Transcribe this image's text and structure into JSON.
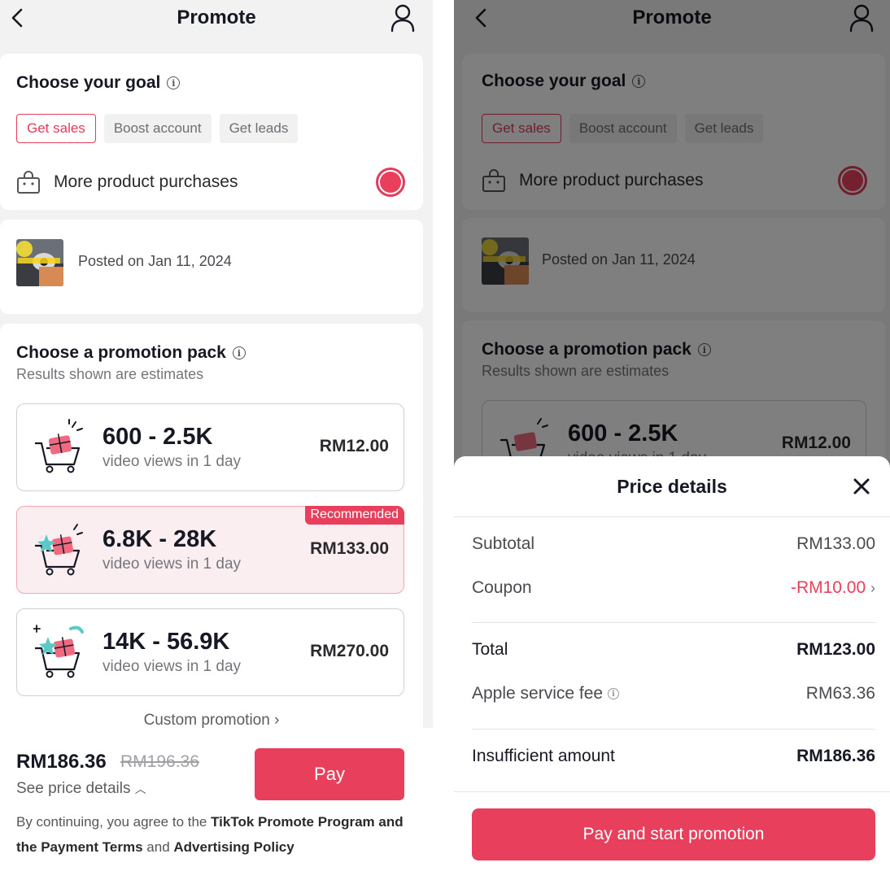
{
  "header": {
    "title": "Promote"
  },
  "goal": {
    "title": "Choose your goal",
    "chips": [
      "Get sales",
      "Boost account",
      "Get leads"
    ],
    "option_label": "More product purchases"
  },
  "post": {
    "posted_text": "Posted on Jan 11, 2024"
  },
  "pack": {
    "title": "Choose a promotion pack",
    "subtitle": "Results shown are estimates",
    "items": [
      {
        "range": "600 - 2.5K",
        "desc": "video views in 1 day",
        "price": "RM12.00"
      },
      {
        "range": "6.8K - 28K",
        "desc": "video views in 1 day",
        "price": "RM133.00",
        "badge": "Recommended"
      },
      {
        "range": "14K - 56.9K",
        "desc": "video views in 1 day",
        "price": "RM270.00"
      }
    ],
    "custom": "Custom promotion"
  },
  "footer": {
    "total": "RM186.36",
    "old_price": "RM196.36",
    "see_details": "See price details",
    "pay_label": "Pay",
    "legal_1": "By continuing, you agree to the ",
    "legal_link_1": "TikTok Promote Program and the Payment Terms",
    "legal_2": " and ",
    "legal_link_2": "Advertising Policy"
  },
  "price_details": {
    "title": "Price details",
    "subtotal_label": "Subtotal",
    "subtotal": "RM133.00",
    "coupon_label": "Coupon",
    "coupon": "-RM10.00",
    "total_label": "Total",
    "total": "RM123.00",
    "fee_label": "Apple service fee",
    "fee": "RM63.36",
    "insufficient_label": "Insufficient amount",
    "insufficient": "RM186.36",
    "button": "Pay and start promotion"
  },
  "colors": {
    "accent": "#e8405c",
    "selected_bg": "#fbeef1"
  }
}
